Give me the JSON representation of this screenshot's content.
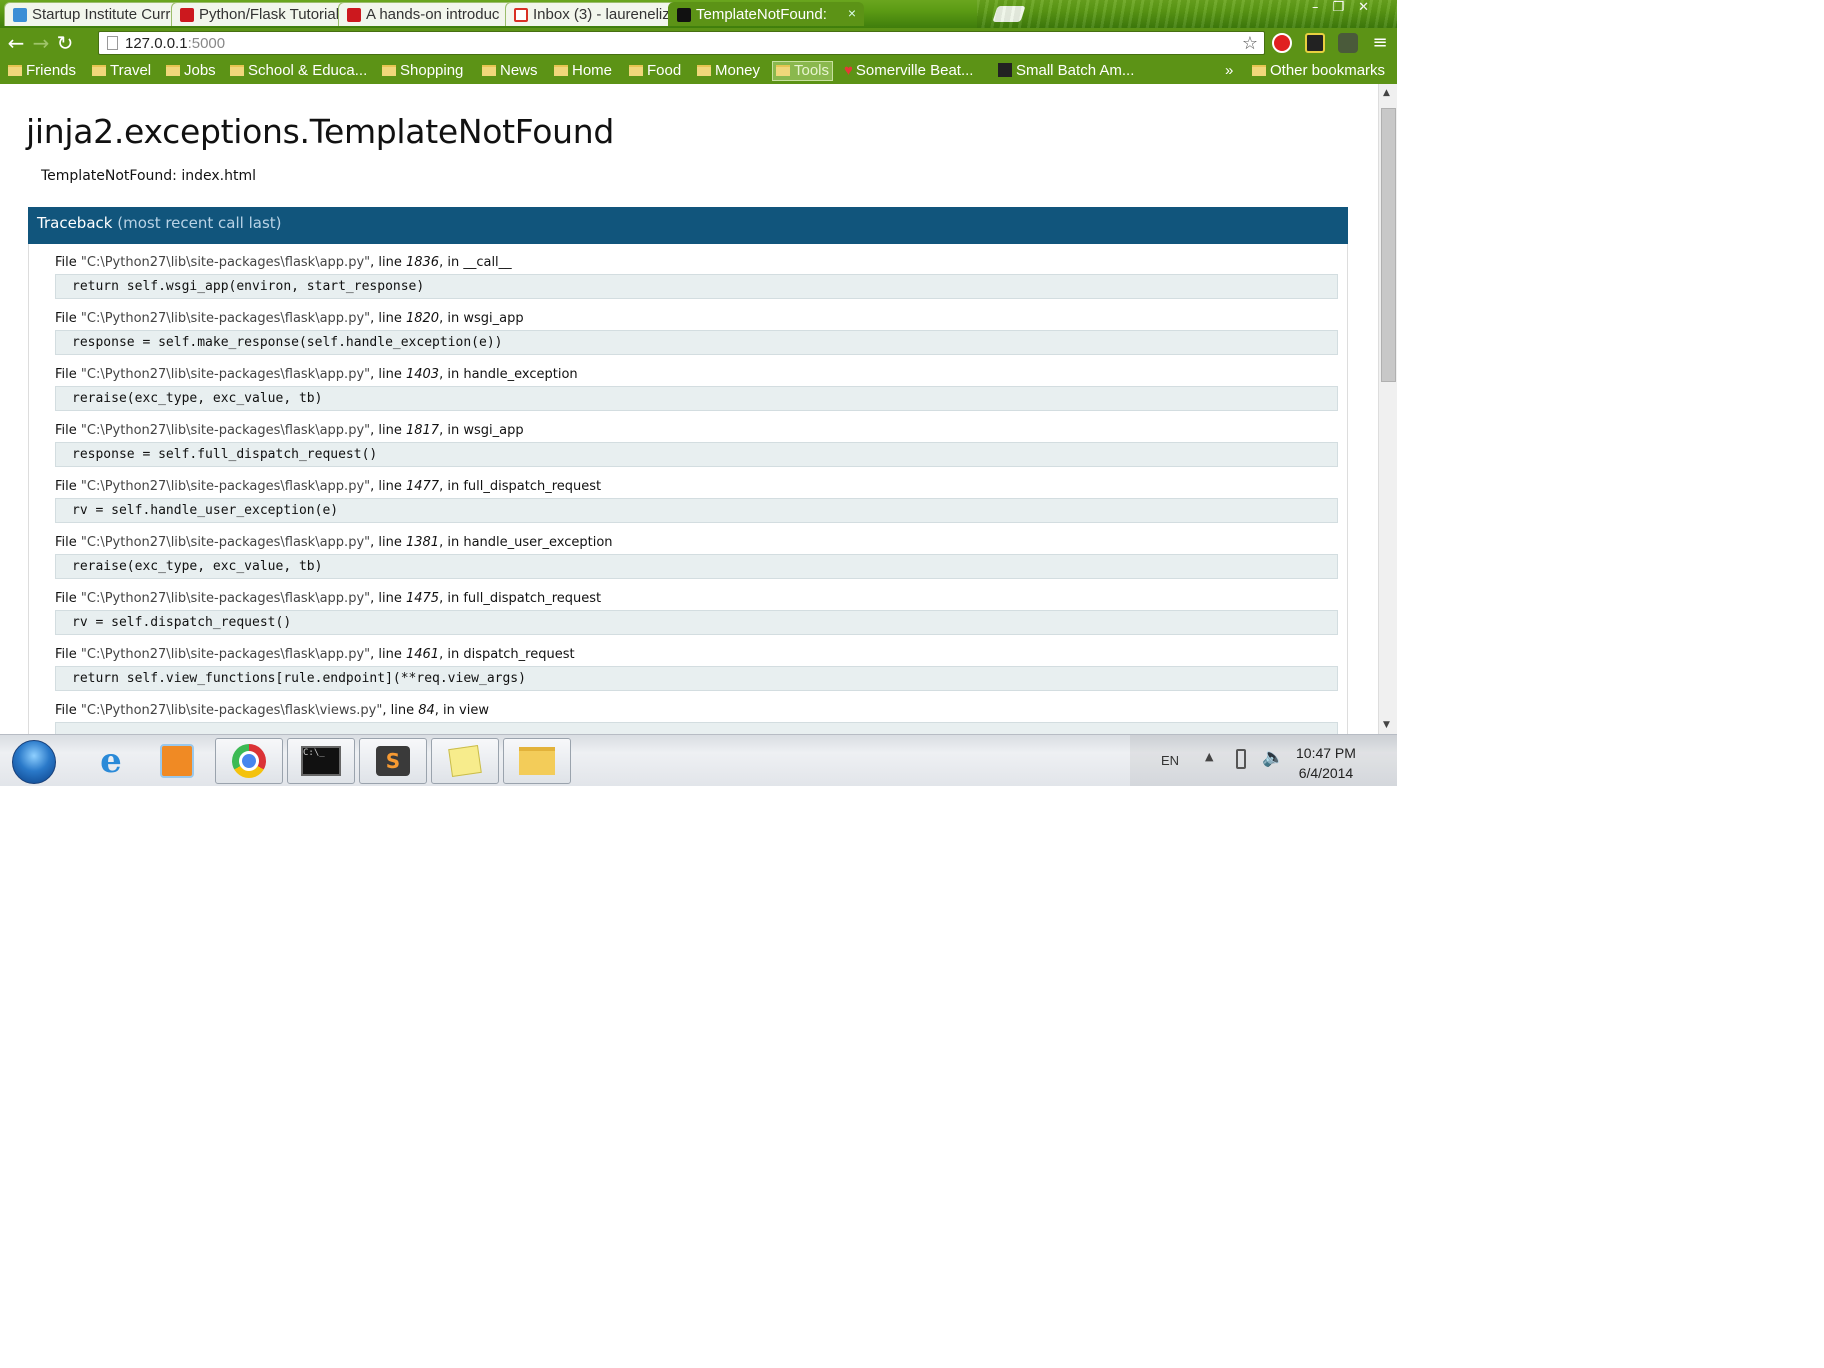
{
  "browser": {
    "tabs": [
      {
        "title": "Startup Institute Curr",
        "favicon_color": "#3b8fd6",
        "active": false
      },
      {
        "title": "Python/Flask Tutorial",
        "favicon_color": "#cc181e",
        "active": false
      },
      {
        "title": "A hands-on introduc",
        "favicon_color": "#cc181e",
        "active": false
      },
      {
        "title": "Inbox (3) - laureneliz",
        "favicon_color": "#d93025",
        "active": false
      },
      {
        "title": "TemplateNotFound:",
        "favicon_color": "#111111",
        "active": true
      }
    ],
    "tab_close_glyph": "×",
    "url_host": "127.0.0.1",
    "url_port": ":5000",
    "bookmarks": [
      {
        "label": "Friends",
        "icon": "folder-icon"
      },
      {
        "label": "Travel",
        "icon": "folder-icon"
      },
      {
        "label": "Jobs",
        "icon": "folder-icon"
      },
      {
        "label": "School & Educa...",
        "icon": "folder-icon"
      },
      {
        "label": "Shopping",
        "icon": "folder-icon"
      },
      {
        "label": "News",
        "icon": "folder-icon"
      },
      {
        "label": "Home",
        "icon": "folder-icon"
      },
      {
        "label": "Food",
        "icon": "folder-icon"
      },
      {
        "label": "Money",
        "icon": "folder-icon"
      },
      {
        "label": "Tools",
        "icon": "folder-icon"
      },
      {
        "label": "Somerville Beat...",
        "icon": "heart-icon"
      },
      {
        "label": "Small Batch Am...",
        "icon": "site-icon"
      }
    ],
    "bookmarks_overflow": "»",
    "other_bookmarks": "Other bookmarks"
  },
  "page": {
    "title": "jinja2.exceptions.TemplateNotFound",
    "error_message": "TemplateNotFound: index.html",
    "traceback_title": "Traceback",
    "traceback_subtitle": "(most recent call last)",
    "frames": [
      {
        "file": "\"C:\\Python27\\lib\\site-packages\\flask\\app.py\"",
        "line": "1836",
        "func": "__call__",
        "code": "return self.wsgi_app(environ, start_response)"
      },
      {
        "file": "\"C:\\Python27\\lib\\site-packages\\flask\\app.py\"",
        "line": "1820",
        "func": "wsgi_app",
        "code": "response = self.make_response(self.handle_exception(e))"
      },
      {
        "file": "\"C:\\Python27\\lib\\site-packages\\flask\\app.py\"",
        "line": "1403",
        "func": "handle_exception",
        "code": "reraise(exc_type, exc_value, tb)"
      },
      {
        "file": "\"C:\\Python27\\lib\\site-packages\\flask\\app.py\"",
        "line": "1817",
        "func": "wsgi_app",
        "code": "response = self.full_dispatch_request()"
      },
      {
        "file": "\"C:\\Python27\\lib\\site-packages\\flask\\app.py\"",
        "line": "1477",
        "func": "full_dispatch_request",
        "code": "rv = self.handle_user_exception(e)"
      },
      {
        "file": "\"C:\\Python27\\lib\\site-packages\\flask\\app.py\"",
        "line": "1381",
        "func": "handle_user_exception",
        "code": "reraise(exc_type, exc_value, tb)"
      },
      {
        "file": "\"C:\\Python27\\lib\\site-packages\\flask\\app.py\"",
        "line": "1475",
        "func": "full_dispatch_request",
        "code": "rv = self.dispatch_request()"
      },
      {
        "file": "\"C:\\Python27\\lib\\site-packages\\flask\\app.py\"",
        "line": "1461",
        "func": "dispatch_request",
        "code": "return self.view_functions[rule.endpoint](**req.view_args)"
      },
      {
        "file": "\"C:\\Python27\\lib\\site-packages\\flask\\views.py\"",
        "line": "84",
        "func": "view",
        "code": ""
      }
    ],
    "labels": {
      "file": "File ",
      "line": ", line ",
      "in": ", in "
    }
  },
  "taskbar": {
    "apps": [
      "internet-explorer-icon",
      "media-player-icon",
      "chrome-icon",
      "command-prompt-icon",
      "sublime-text-icon",
      "sticky-notes-icon",
      "file-explorer-icon"
    ],
    "language": "EN",
    "time": "10:47 PM",
    "date": "6/4/2014"
  },
  "colors": {
    "chrome_frame": "#5c9316",
    "traceback_header": "#11557c",
    "code_background": "#e8eff0"
  }
}
